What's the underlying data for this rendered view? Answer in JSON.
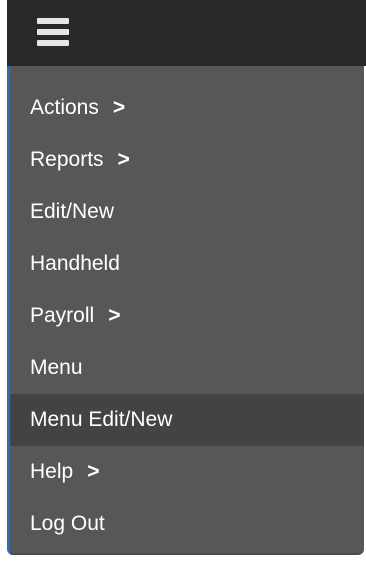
{
  "header": {
    "menu_icon": "hamburger-menu-icon"
  },
  "menu": {
    "items": [
      {
        "label": "Actions",
        "submenu_indicator": ">"
      },
      {
        "label": "Reports",
        "submenu_indicator": ">"
      },
      {
        "label": "Edit/New",
        "submenu_indicator": ""
      },
      {
        "label": "Handheld",
        "submenu_indicator": ""
      },
      {
        "label": "Payroll",
        "submenu_indicator": ">"
      },
      {
        "label": "Menu",
        "submenu_indicator": ""
      },
      {
        "label": "Menu Edit/New",
        "submenu_indicator": ""
      },
      {
        "label": "Help",
        "submenu_indicator": ">"
      },
      {
        "label": "Log Out",
        "submenu_indicator": ""
      }
    ],
    "highlighted_item": "Menu Edit/New"
  },
  "colors": {
    "topbar": "#292929",
    "panel": "#575757",
    "highlight": "#434343",
    "accent_border": "#2c6db3",
    "text": "#ffffff"
  }
}
